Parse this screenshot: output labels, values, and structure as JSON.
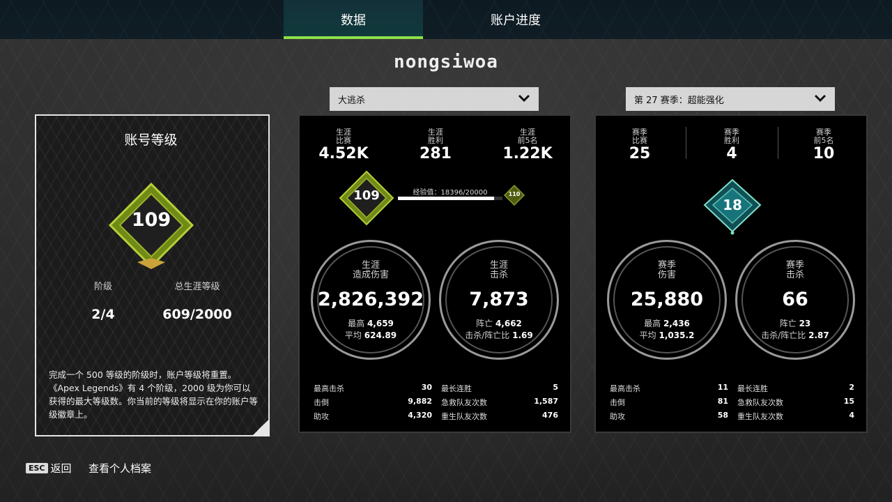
{
  "tabs": [
    {
      "label": "数据",
      "active": true
    },
    {
      "label": "账户进度",
      "active": false
    }
  ],
  "username": "nongsiwoa",
  "mode_dropdown": {
    "value": "大逃杀"
  },
  "season_dropdown": {
    "value": "第 27 赛季：超能强化"
  },
  "account_level": {
    "title": "账号等级",
    "level": "109",
    "tier_label": "阶级",
    "tier_value": "2/4",
    "total_label": "总生涯等级",
    "total_value": "609/2000",
    "description": "完成一个 500 等级的阶级时，账户等级将重置。《Apex Legends》有 4 个阶级，2000 级为你可以获得的最大等级数。你当前的等级将显示在你的账户等级徽章上。"
  },
  "career": {
    "top": [
      {
        "label1": "生涯",
        "label2": "比赛",
        "value": "4.52K"
      },
      {
        "label1": "生涯",
        "label2": "胜利",
        "value": "281"
      },
      {
        "label1": "生涯",
        "label2": "前5名",
        "value": "1.22K"
      }
    ],
    "badge_level": "109",
    "next_level": "110",
    "xp_label": "经验值：18396/20000",
    "xp_progress": 0.92,
    "damage": {
      "title1": "生涯",
      "title2": "造成伤害",
      "value": "2,826,392",
      "sub1_label": "最高",
      "sub1_value": "4,659",
      "sub2_label": "平均",
      "sub2_value": "624.89"
    },
    "kills": {
      "title1": "生涯",
      "title2": "击杀",
      "value": "7,873",
      "sub1_label": "阵亡",
      "sub1_value": "4,662",
      "sub2_label": "击杀/阵亡比",
      "sub2_value": "1.69"
    },
    "stats_left": [
      {
        "label": "最高击杀",
        "value": "30"
      },
      {
        "label": "击倒",
        "value": "9,882"
      },
      {
        "label": "助攻",
        "value": "4,320"
      }
    ],
    "stats_right": [
      {
        "label": "最长连胜",
        "value": "5"
      },
      {
        "label": "急救队友次数",
        "value": "1,587"
      },
      {
        "label": "重生队友次数",
        "value": "476"
      }
    ]
  },
  "season": {
    "top": [
      {
        "label1": "赛季",
        "label2": "比赛",
        "value": "25"
      },
      {
        "label1": "赛季",
        "label2": "胜利",
        "value": "4"
      },
      {
        "label1": "赛季",
        "label2": "前5名",
        "value": "10"
      }
    ],
    "badge_level": "18",
    "damage": {
      "title1": "赛季",
      "title2": "伤害",
      "value": "25,880",
      "sub1_label": "最高",
      "sub1_value": "2,436",
      "sub2_label": "平均",
      "sub2_value": "1,035.2"
    },
    "kills": {
      "title1": "赛季",
      "title2": "击杀",
      "value": "66",
      "sub1_label": "阵亡",
      "sub1_value": "23",
      "sub2_label": "击杀/阵亡比",
      "sub2_value": "2.87"
    },
    "stats_left": [
      {
        "label": "最高击杀",
        "value": "11"
      },
      {
        "label": "击倒",
        "value": "81"
      },
      {
        "label": "助攻",
        "value": "58"
      }
    ],
    "stats_right": [
      {
        "label": "最长连胜",
        "value": "2"
      },
      {
        "label": "急救队友次数",
        "value": "15"
      },
      {
        "label": "重生队友次数",
        "value": "4"
      }
    ]
  },
  "footer": {
    "esc_key": "ESC",
    "back_label": "返回",
    "profile_label": "查看个人档案"
  },
  "colors": {
    "accent_green": "#8fe04a",
    "badge_gold": "#9bb32a",
    "badge_teal": "#1d6f73"
  }
}
